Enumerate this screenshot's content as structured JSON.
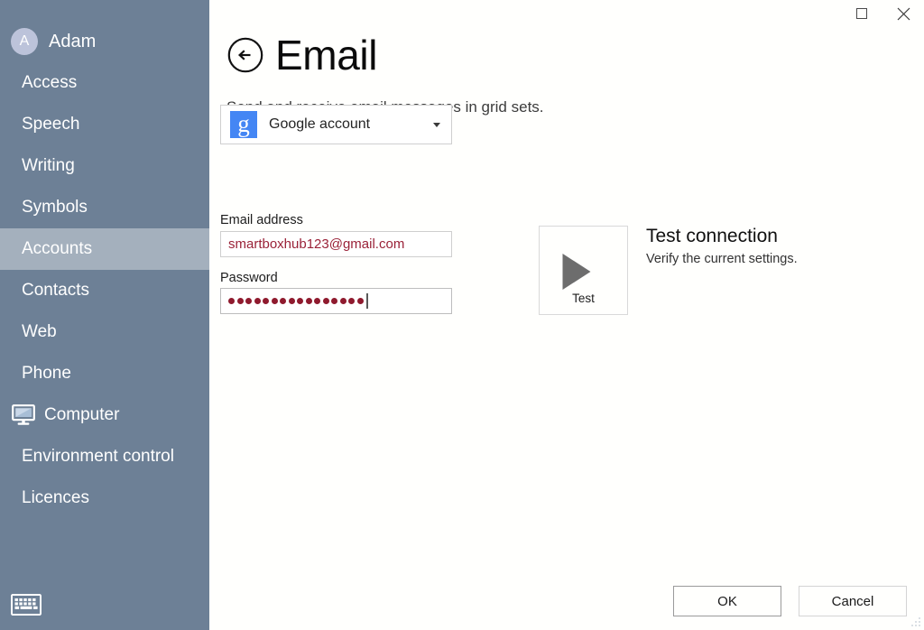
{
  "window": {
    "maximize_icon": "maximize-square-icon",
    "close_icon": "close-x-icon",
    "resize_grip_icon": "resize-grip-icon"
  },
  "sidebar": {
    "user": {
      "avatar_initial": "A",
      "name": "Adam",
      "avatar_color": "#bcc3da"
    },
    "background_color": "#6d8096",
    "selected_color": "#a4b0bd",
    "items": [
      {
        "label": "Access",
        "icon": null,
        "selected": false
      },
      {
        "label": "Speech",
        "icon": null,
        "selected": false
      },
      {
        "label": "Writing",
        "icon": null,
        "selected": false
      },
      {
        "label": "Symbols",
        "icon": null,
        "selected": false
      },
      {
        "label": "Accounts",
        "icon": null,
        "selected": true
      },
      {
        "label": "Contacts",
        "icon": null,
        "selected": false
      },
      {
        "label": "Web",
        "icon": null,
        "selected": false
      },
      {
        "label": "Phone",
        "icon": null,
        "selected": false
      },
      {
        "label": "Computer",
        "icon": "monitor-icon",
        "selected": false
      },
      {
        "label": "Environment control",
        "icon": null,
        "selected": false
      },
      {
        "label": "Licences",
        "icon": null,
        "selected": false
      }
    ],
    "keyboard_icon": "onscreen-keyboard-icon"
  },
  "header": {
    "back_icon": "back-arrow-circle-icon",
    "title": "Email",
    "subtitle": "Send and receive email messages in grid sets."
  },
  "account_select": {
    "icon": "google-g-icon",
    "icon_color": "#4486f4",
    "value": "Google account",
    "caret_icon": "chevron-down-icon"
  },
  "form": {
    "email": {
      "label": "Email address",
      "value": "smartboxhub123@gmail.com",
      "text_color": "#9a2238"
    },
    "password": {
      "label": "Password",
      "masked_value": "••••••••••••••••",
      "dot_count": 16,
      "dot_color": "#8f1a2e",
      "focused": true
    }
  },
  "test_connection": {
    "button_icon": "play-triangle-icon",
    "button_caption": "Test",
    "title": "Test connection",
    "description": "Verify the current settings."
  },
  "footer": {
    "ok_label": "OK",
    "cancel_label": "Cancel"
  }
}
